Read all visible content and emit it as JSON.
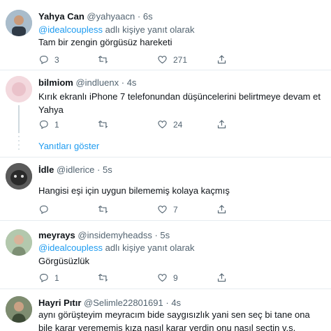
{
  "tweets": [
    {
      "name": "Yahya Can",
      "handle": "@yahyaacn",
      "time": "6s",
      "reply_mention": "@idealcoupless",
      "reply_suffix": "adlı kişiye yanıt olarak",
      "text": "Tam bir zengin görgüsüz hareketi",
      "replies": "3",
      "retweets": "",
      "likes": "271",
      "avatar_color": "#8fa5b8"
    },
    {
      "name": "bilmiom",
      "handle": "@indluenx",
      "time": "4s",
      "text": "Kırık ekranlı iPhone 7 telefonundan düşüncelerini belirtmeye devam et Yahya",
      "replies": "1",
      "retweets": "",
      "likes": "24",
      "avatar_color": "#f1d4d9"
    },
    {
      "name": "İdle",
      "handle": "@idlerice",
      "time": "5s",
      "text": "Hangisi eşi için uygun bilememiş kolaya kaçmış",
      "replies": "",
      "retweets": "",
      "likes": "7",
      "avatar_color": "#4a4a4a"
    },
    {
      "name": "meyrays",
      "handle": "@insidemyheadss",
      "time": "5s",
      "reply_mention": "@idealcoupless",
      "reply_suffix": "adlı kişiye yanıt olarak",
      "text": "Görgüsüzlük",
      "replies": "1",
      "retweets": "",
      "likes": "9",
      "avatar_color": "#9fb89a"
    },
    {
      "name": "Hayri Pıtır",
      "handle": "@Selimle22801691",
      "time": "4s",
      "text": "aynı görüşteyim meyracım bide saygısızlık yani sen seç bi tane ona bile karar verememiş kıza nasıl karar verdin onu nasıl seçtin v.s.",
      "avatar_color": "#6b7a5e"
    }
  ],
  "show_replies": "Yanıtları göster",
  "separator_dot": "·",
  "colors": {
    "accent": "#1d9bf0",
    "secondary_text": "#536471",
    "divider": "#e6ecf0"
  }
}
